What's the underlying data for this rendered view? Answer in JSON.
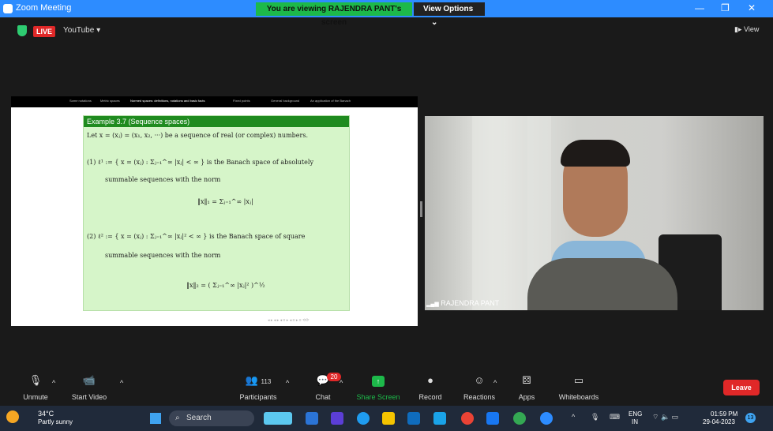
{
  "titlebar": {
    "title": "Zoom Meeting",
    "viewing_banner": "You are viewing RAJENDRA PANT's screen",
    "view_options": "View Options",
    "view_options_caret": "⌄",
    "minimize": "—",
    "maximize": "❐",
    "close": "✕"
  },
  "meeting_bar": {
    "live_badge": "LIVE",
    "stream_target": "YouTube",
    "stream_caret": "▾",
    "view_button": "View",
    "view_icon": "▮▸"
  },
  "slide": {
    "nav_items": [
      "Some notations",
      "Metric spaces",
      "Normed spaces: definitions, notations and basic facts",
      "Fixed points",
      "General background",
      "An application of the Banach"
    ],
    "example_title": "Example 3.7 (Sequence spaces)",
    "line_intro": "Let x = (xⱼ) = (x₁, x₂, ···) be a sequence of real (or complex) numbers.",
    "line_l1_def": "(1)  ℓ¹ := { x = (xⱼ) : Σⱼ₌₁^∞ |xⱼ| < ∞ }  is the Banach space of absolutely",
    "line_l1_cont": "summable sequences with the norm",
    "line_l1_norm": "‖x‖₁ = Σⱼ₌₁^∞ |xⱼ|",
    "line_l2_def": "(2)  ℓ² := { x = (xⱼ) : Σⱼ₌₁^∞ |xⱼ|² < ∞ }  is the Banach space of square",
    "line_l2_cont": "summable sequences with the norm",
    "line_l2_norm": "‖x‖₂ = ( Σⱼ₌₁^∞ |xⱼ|² )^½",
    "footer": "◂ ▸ ◂ ▸ ◂ ≡ ▸ ◂ ≡ ▸  ≡  ⟲⟳"
  },
  "video": {
    "participant_name": "RAJENDRA PANT",
    "signal_icon": "▂▄▆"
  },
  "toolbar": {
    "unmute": "Unmute",
    "start_video": "Start Video",
    "participants": "Participants",
    "participants_count": "113",
    "chat": "Chat",
    "chat_badge": "20",
    "share_screen": "Share Screen",
    "record": "Record",
    "reactions": "Reactions",
    "apps": "Apps",
    "whiteboards": "Whiteboards",
    "leave": "Leave",
    "caret": "^",
    "icons": {
      "unmute": "🎙",
      "video": "📹",
      "participants": "👥",
      "chat": "💬",
      "share": "↑",
      "record": "●",
      "reactions": "☺",
      "apps": "⚄",
      "whiteboards": "▭"
    }
  },
  "taskbar": {
    "temperature": "34°C",
    "weather": "Partly sunny",
    "search_placeholder": "Search",
    "search_icon": "⌕",
    "tray_chevron": "^",
    "tray_mic": "🎙",
    "tray_keyboard": "⌨",
    "tray_net_vol_batt": "⌔ 🔈 ▭",
    "lang_line1": "ENG",
    "lang_line2": "IN",
    "time": "01:59 PM",
    "date": "29-04-2023",
    "notification_count": "13",
    "app_colors": [
      "#5cc8f0",
      "#2b74d6",
      "#5b3ed6",
      "#1f9cf0",
      "#f5c400",
      "#0f6cbd",
      "#1aa3e8",
      "#ea4335",
      "#1877f2",
      "#34a853",
      "#2d8cff"
    ]
  }
}
